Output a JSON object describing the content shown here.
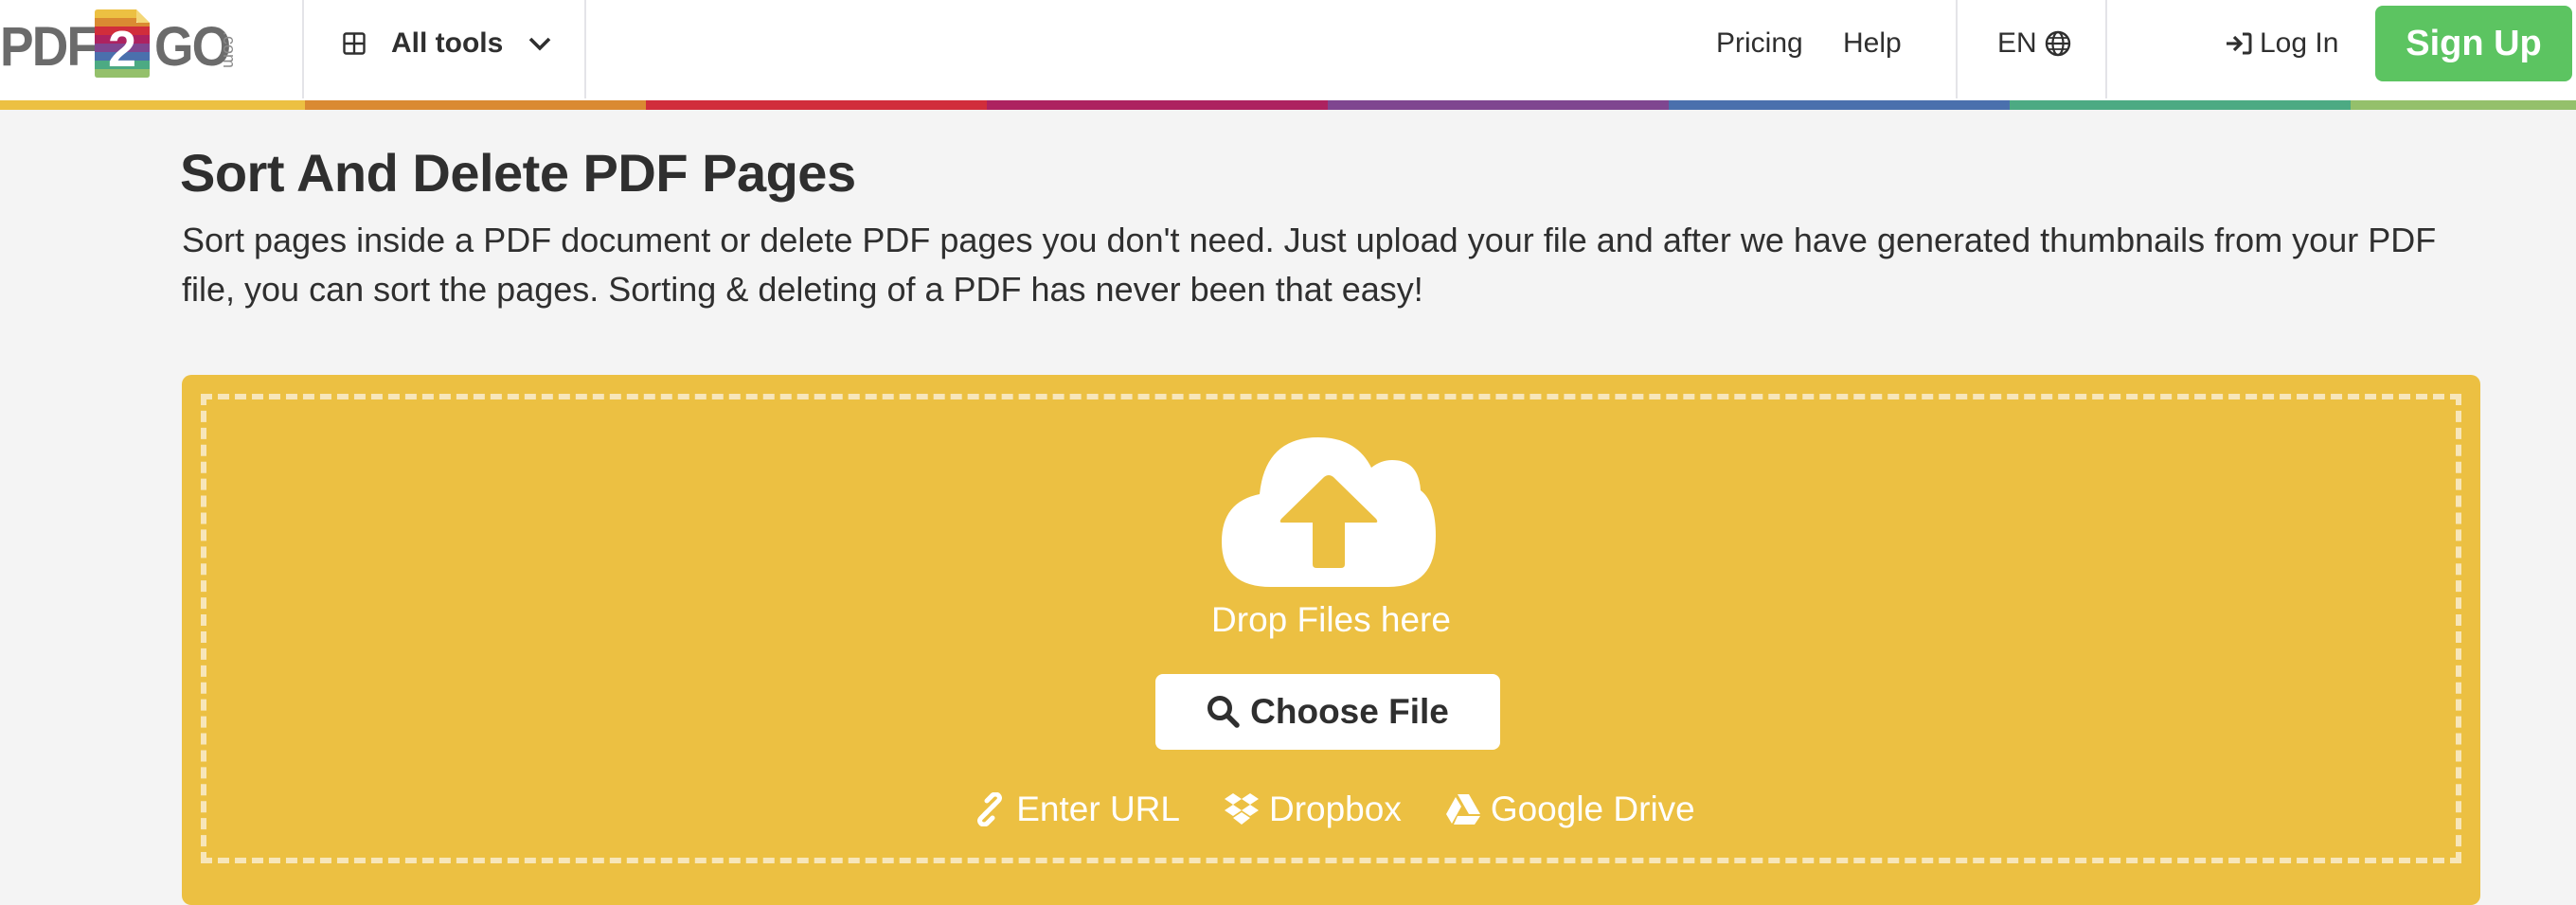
{
  "header": {
    "logo": {
      "left_text": "PDF",
      "middle_text": "2",
      "right_text": "GO",
      "suffix": ".com"
    },
    "all_tools": {
      "label": "All tools",
      "icon": "grid-icon",
      "chevron": "chevron-down-icon"
    },
    "nav": [
      {
        "label": "Pricing"
      },
      {
        "label": "Help"
      }
    ],
    "language": {
      "label": "EN",
      "icon": "globe-icon"
    },
    "login": {
      "label": "Log In",
      "icon": "sign-in-icon"
    },
    "signup": {
      "label": "Sign Up"
    }
  },
  "colors": {
    "brand_bar": [
      "#ecc042",
      "#da8a32",
      "#d12d3b",
      "#ad2260",
      "#7f4690",
      "#4a70ad",
      "#4caa83",
      "#94c06b"
    ],
    "dropzone": "#ecc042",
    "signup": "#5cc461"
  },
  "main": {
    "title": "Sort And Delete PDF Pages",
    "description": "Sort pages inside a PDF document or delete PDF pages you don't need. Just upload your file and after we have generated thumbnails from your PDF file, you can sort the pages. Sorting & deleting of a PDF has never been that easy!",
    "upload": {
      "icon": "cloud-upload-icon",
      "drop_text": "Drop Files here",
      "choose_file": {
        "label": "Choose File",
        "icon": "search-icon"
      },
      "sources": [
        {
          "label": "Enter URL",
          "icon": "link-icon"
        },
        {
          "label": "Dropbox",
          "icon": "dropbox-icon"
        },
        {
          "label": "Google Drive",
          "icon": "google-drive-icon"
        }
      ]
    }
  }
}
